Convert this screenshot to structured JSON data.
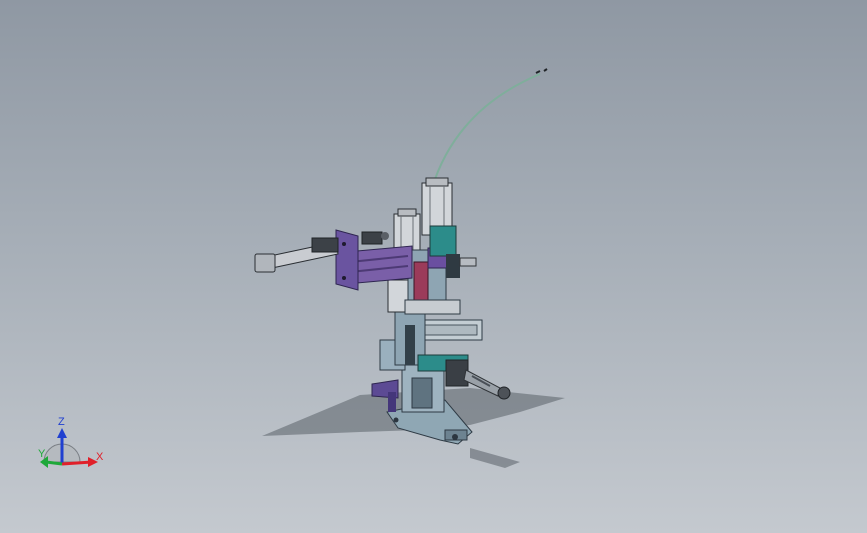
{
  "viewport": {
    "background_top": "#8f98a3",
    "background_bottom": "#c4c9cf"
  },
  "triad": {
    "x_label": "X",
    "y_label": "Y",
    "z_label": "Z",
    "x_color": "#e0202a",
    "y_color": "#1fa83a",
    "z_color": "#2040d0",
    "icon": "axis-triad-icon"
  },
  "model": {
    "icon": "mechanical-assembly-icon",
    "colors": {
      "frame": "#8fa3b2",
      "frame_dark": "#5e6f7c",
      "purple": "#7a5fa8",
      "purple_dark": "#4d3a75",
      "teal": "#2c8c8a",
      "metal": "#c9ccd1",
      "hose": "#7fae9b",
      "shadow": "#4a5058"
    }
  }
}
